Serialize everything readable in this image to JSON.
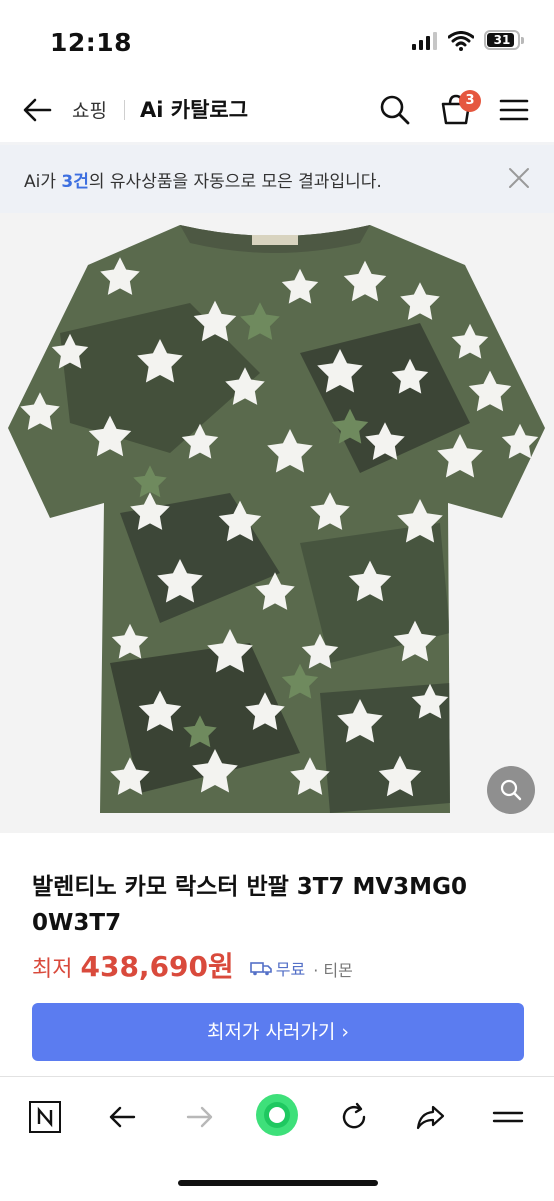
{
  "status_bar": {
    "time": "12:18",
    "battery": "31"
  },
  "nav": {
    "section": "쇼핑",
    "title": "Ai 카탈로그",
    "cart_count": "3"
  },
  "ai_banner": {
    "prefix": "Ai가 ",
    "count": "3건",
    "suffix": "의 유사상품을 자동으로 모은 결과입니다."
  },
  "product": {
    "title": "발렌티노 카모 락스터 반팔 3T7 MV3MG0 0W3T7",
    "price_label": "최저",
    "price": "438,690원",
    "shipping": "무료",
    "seller": "· 티몬",
    "cta": "최저가 사러가기 ›"
  },
  "colors": {
    "accent": "#5b7cf0",
    "price": "#d94a3c",
    "badge": "#e5573f",
    "shirt": "#5a6a4d"
  },
  "icons": {
    "nav": [
      "back-arrow-icon",
      "search-icon",
      "cart-icon",
      "menu-icon"
    ],
    "browser": [
      "naver-icon",
      "back-icon",
      "forward-icon",
      "home-icon",
      "reload-icon",
      "share-icon",
      "menu-icon"
    ]
  }
}
